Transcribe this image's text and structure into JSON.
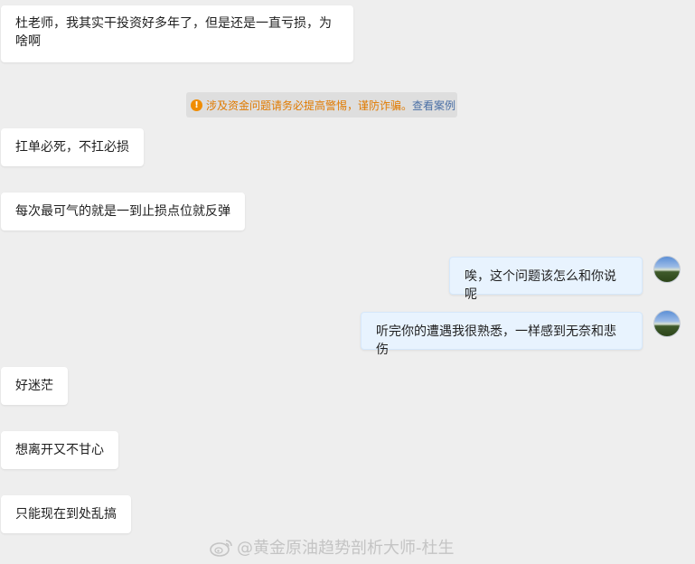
{
  "messages_left": [
    {
      "text": "杜老师，我其实干投资好多年了，但是还是一直亏损，为啥啊"
    },
    {
      "text": "扛单必死，不扛必损"
    },
    {
      "text": "每次最可气的就是一到止损点位就反弹"
    },
    {
      "text": "好迷茫"
    },
    {
      "text": "想离开又不甘心"
    },
    {
      "text": "只能现在到处乱搞"
    }
  ],
  "messages_right": [
    {
      "text": "唉，这个问题该怎么和你说呢"
    },
    {
      "text": "听完你的遭遇我很熟悉，一样感到无奈和悲伤"
    }
  ],
  "notice": {
    "icon": "!",
    "warning_text": "涉及资金问题请务必提高警惕，谨防诈骗。",
    "link_text": "查看案例"
  },
  "watermark": {
    "text": "@黄金原油趋势剖析大师-杜生",
    "icon": "weibo-logo-icon"
  },
  "colors": {
    "background": "#eeeeee",
    "left_bubble": "#ffffff",
    "right_bubble": "#e8f3fe",
    "warning": "#e07a00",
    "link": "#4a6fa5"
  }
}
